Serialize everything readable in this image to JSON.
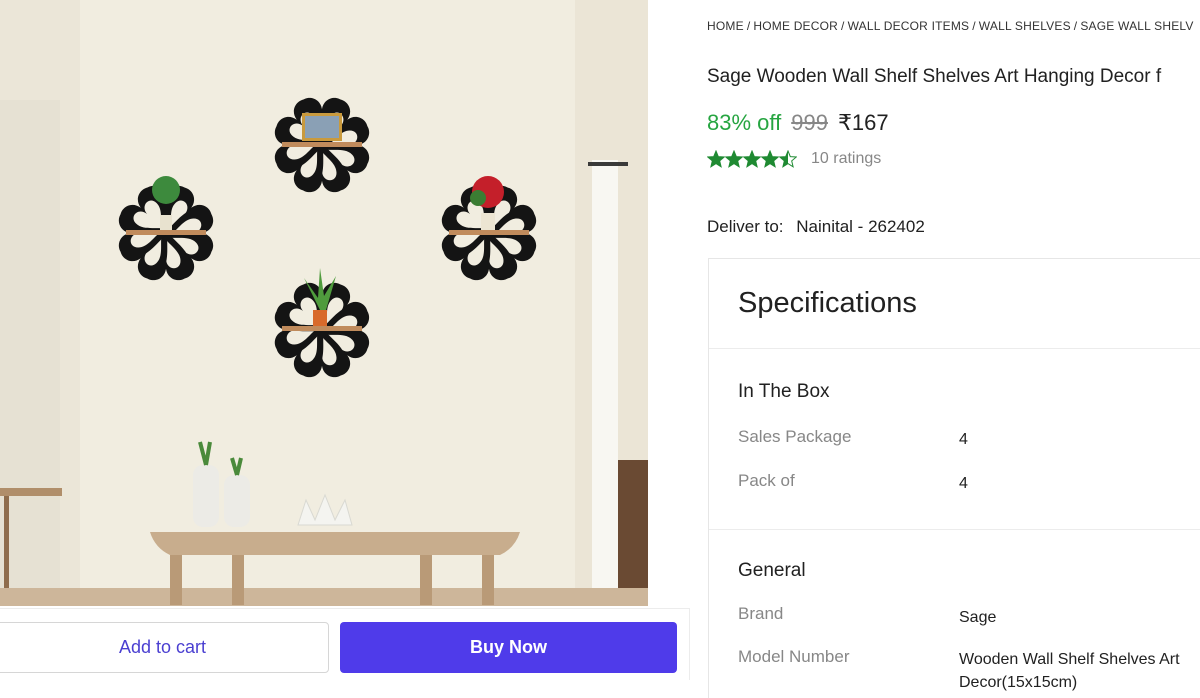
{
  "actions": {
    "add_to_cart": "Add to cart",
    "buy_now": "Buy Now"
  },
  "breadcrumb": [
    "HOME",
    "HOME DECOR",
    "WALL DECOR ITEMS",
    "WALL SHELVES",
    "SAGE WALL SHELV"
  ],
  "product": {
    "title": "Sage Wooden Wall Shelf Shelves Art Hanging Decor f",
    "discount": "83% off",
    "mrp": "999",
    "price": "₹167",
    "rating_stars": 4.5,
    "ratings_text": "10 ratings",
    "rating_color": "#1f8a32"
  },
  "delivery": {
    "label": "Deliver to:",
    "location": "Nainital - 262402"
  },
  "specifications": {
    "heading": "Specifications",
    "groups": [
      {
        "title": "In The Box",
        "rows": [
          {
            "key": "Sales Package",
            "value": "4"
          },
          {
            "key": "Pack of",
            "value": "4"
          }
        ]
      },
      {
        "title": "General",
        "rows": [
          {
            "key": "Brand",
            "value": "Sage"
          },
          {
            "key": "Model Number",
            "value": "Wooden Wall Shelf Shelves Art Decor(15x15cm)"
          }
        ]
      }
    ]
  },
  "colors": {
    "accent": "#4f3bea",
    "discount_green": "#26a541",
    "muted": "#878787"
  }
}
